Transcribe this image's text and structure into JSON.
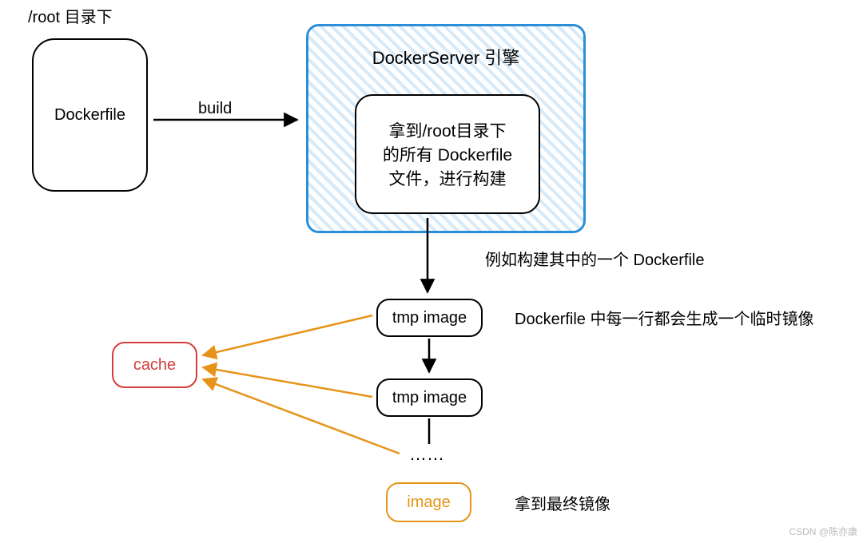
{
  "boxes": {
    "root_label": "/root 目录下",
    "dockerfile": "Dockerfile",
    "build_label": "build",
    "server_title": "DockerServer 引擎",
    "server_inner": "拿到/root目录下\n的所有 Dockerfile\n文件，进行构建",
    "annotation_right_top": "例如构建其中的一个 Dockerfile",
    "tmp_image_1": "tmp image",
    "annotation_tmp": "Dockerfile 中每一行都会生成一个临时镜像",
    "cache": "cache",
    "tmp_image_2": "tmp image",
    "ellipsis": "……",
    "image": "image",
    "annotation_final": "拿到最终镜像",
    "watermark": "CSDN @陈亦康"
  }
}
